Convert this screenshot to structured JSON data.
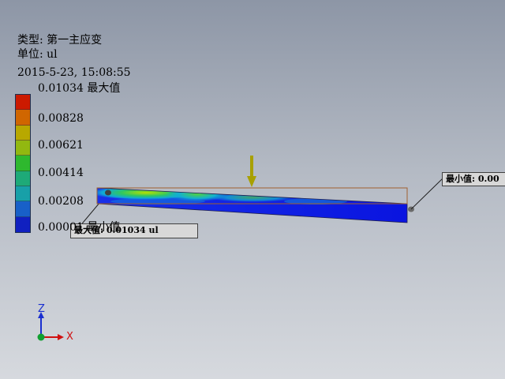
{
  "header": {
    "type_line": "类型: 第一主应变",
    "unit_line": "单位: ul",
    "timestamp": "2015-5-23, 15:08:55"
  },
  "legend": {
    "colors": [
      "#cc1a00",
      "#d06600",
      "#b8a800",
      "#92b810",
      "#2eb82e",
      "#1eaa78",
      "#18a0a8",
      "#1860c8",
      "#1020c0"
    ],
    "labels": [
      {
        "value": "0.01034",
        "suffix": "最大值"
      },
      {
        "value": "0.00828",
        "suffix": ""
      },
      {
        "value": "0.00621",
        "suffix": ""
      },
      {
        "value": "0.00414",
        "suffix": ""
      },
      {
        "value": "0.00208",
        "suffix": ""
      },
      {
        "value": "0.00001",
        "suffix": "最小值"
      }
    ]
  },
  "callouts": {
    "min_text": "最小值: 0.00",
    "max_text": "最大值: 0.01034 ul"
  },
  "axes": {
    "z_label": "Z",
    "x_label": "X",
    "z_color": "#1a2fd0",
    "x_color": "#d01010",
    "origin_color": "#10a030"
  },
  "load_arrow_color": "#a8a000"
}
